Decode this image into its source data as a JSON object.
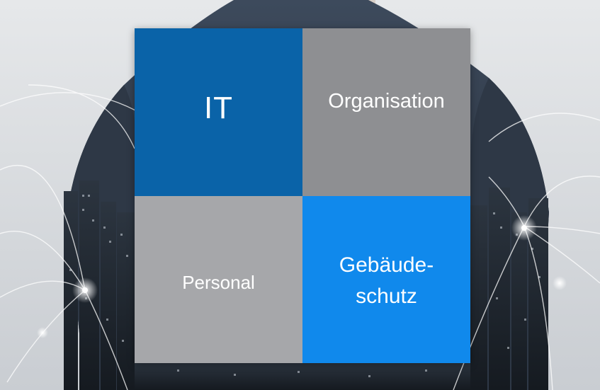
{
  "tiles": {
    "it": "IT",
    "organisation": "Organisation",
    "personal": "Personal",
    "gebaeude_line1": "Gebäude-",
    "gebaeude_line2": "schutz"
  },
  "colors": {
    "it": "#0a63a8",
    "organisation": "#8e8f92",
    "personal": "#a6a7aa",
    "gebaeude": "#1089ec"
  }
}
